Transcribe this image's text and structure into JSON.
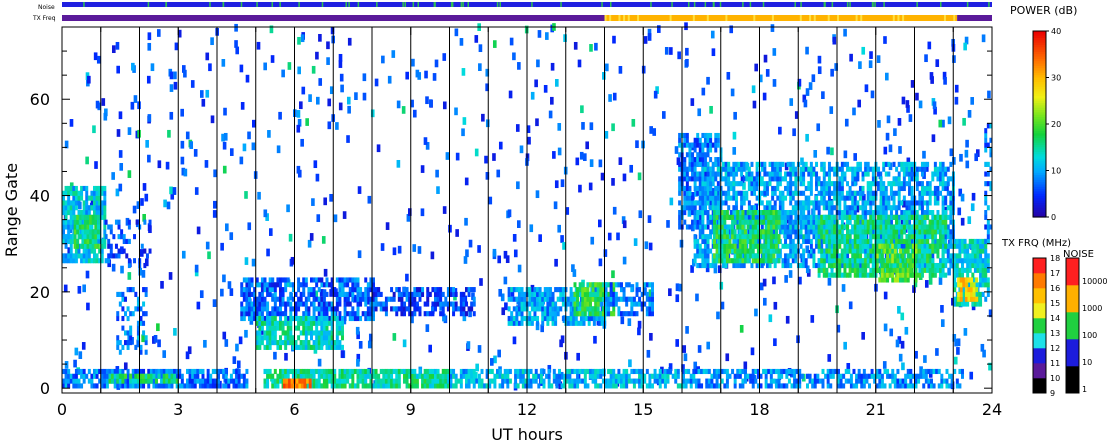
{
  "chart_data": {
    "type": "heatmap",
    "xlabel": "UT hours",
    "ylabel": "Range Gate",
    "xlim": [
      0,
      24
    ],
    "ylim": [
      -1,
      75
    ],
    "x_ticks": [
      0,
      3,
      6,
      9,
      12,
      15,
      18,
      21,
      24
    ],
    "y_ticks": [
      0,
      20,
      40,
      60
    ],
    "vertical_beam_lines_hours": [
      1,
      2,
      3,
      4,
      5,
      6,
      7,
      8,
      9,
      10,
      11,
      12,
      13,
      14,
      15,
      16,
      17,
      18,
      19,
      20,
      21,
      22,
      23
    ],
    "header_bars": {
      "noise_label": "Noise",
      "freq_label": "TX Freq",
      "noise_color": "#2020e0",
      "freq_segments": [
        {
          "from_hour": 0,
          "to_hour": 14,
          "color": "#5a1a9a"
        },
        {
          "from_hour": 14,
          "to_hour": 23.1,
          "color": "#ffb300"
        },
        {
          "from_hour": 23.1,
          "to_hour": 24,
          "color": "#5a1a9a"
        }
      ]
    },
    "power_colorbar": {
      "title": "POWER (dB)",
      "range": [
        0,
        40
      ],
      "ticks": [
        0,
        10,
        20,
        30,
        40
      ]
    },
    "freq_colorbar": {
      "title": "TX FRQ (MHz)",
      "ticks": [
        9,
        10,
        11,
        12,
        13,
        14,
        15,
        16,
        17,
        18
      ],
      "colors": [
        "#000000",
        "#5a1a9a",
        "#1c1cdc",
        "#1ee0e8",
        "#20d040",
        "#f0f020",
        "#ffc000",
        "#ff7a00",
        "#ff2020"
      ]
    },
    "noise_colorbar": {
      "title": "NOISE",
      "ticks": [
        "1",
        "10",
        "100",
        "1000",
        "10000"
      ],
      "colors": [
        "#000000",
        "#1c1cdc",
        "#20d040",
        "#ffb000",
        "#ff2020"
      ]
    },
    "echo_regions": [
      {
        "t0": 0.0,
        "t1": 1.1,
        "g0": 26,
        "g1": 42,
        "power": 12,
        "density": 0.75
      },
      {
        "t0": 0.3,
        "t1": 0.9,
        "g0": 29,
        "g1": 36,
        "power": 17,
        "density": 0.8
      },
      {
        "t0": 1.1,
        "t1": 2.3,
        "g0": 25,
        "g1": 35,
        "power": 6,
        "density": 0.25
      },
      {
        "t0": 1.4,
        "t1": 2.2,
        "g0": 7,
        "g1": 21,
        "power": 8,
        "density": 0.35
      },
      {
        "t0": 0.0,
        "t1": 4.8,
        "g0": 0,
        "g1": 4,
        "power": 8,
        "density": 0.8
      },
      {
        "t0": 1.2,
        "t1": 3.0,
        "g0": 1,
        "g1": 3,
        "power": 16,
        "density": 0.75
      },
      {
        "t0": 4.6,
        "t1": 8.0,
        "g0": 14,
        "g1": 23,
        "power": 7,
        "density": 0.7
      },
      {
        "t0": 5.0,
        "t1": 7.2,
        "g0": 8,
        "g1": 15,
        "power": 14,
        "density": 0.75
      },
      {
        "t0": 8.0,
        "t1": 10.6,
        "g0": 15,
        "g1": 21,
        "power": 6,
        "density": 0.6
      },
      {
        "t0": 5.2,
        "t1": 10.0,
        "g0": 0,
        "g1": 4,
        "power": 15,
        "density": 0.85
      },
      {
        "t0": 5.7,
        "t1": 6.4,
        "g0": 0,
        "g1": 2,
        "power": 33,
        "density": 0.85
      },
      {
        "t0": 10.0,
        "t1": 16.0,
        "g0": 0,
        "g1": 4,
        "power": 11,
        "density": 0.7
      },
      {
        "t0": 16.0,
        "t1": 23.2,
        "g0": 0,
        "g1": 4,
        "power": 9,
        "density": 0.6
      },
      {
        "t0": 11.5,
        "t1": 14.0,
        "g0": 13,
        "g1": 21,
        "power": 10,
        "density": 0.75
      },
      {
        "t0": 13.2,
        "t1": 14.2,
        "g0": 15,
        "g1": 22,
        "power": 18,
        "density": 0.8
      },
      {
        "t0": 14.0,
        "t1": 15.2,
        "g0": 15,
        "g1": 22,
        "power": 8,
        "density": 0.6
      },
      {
        "t0": 15.9,
        "t1": 17.0,
        "g0": 33,
        "g1": 53,
        "power": 8,
        "density": 0.65
      },
      {
        "t0": 16.3,
        "t1": 23.0,
        "g0": 25,
        "g1": 47,
        "power": 10,
        "density": 0.7
      },
      {
        "t0": 16.8,
        "t1": 18.5,
        "g0": 26,
        "g1": 37,
        "power": 17,
        "density": 0.75
      },
      {
        "t0": 19.5,
        "t1": 22.8,
        "g0": 23,
        "g1": 36,
        "power": 16,
        "density": 0.75
      },
      {
        "t0": 21.0,
        "t1": 22.0,
        "g0": 22,
        "g1": 30,
        "power": 20,
        "density": 0.7
      },
      {
        "t0": 23.0,
        "t1": 23.9,
        "g0": 17,
        "g1": 31,
        "power": 13,
        "density": 0.8
      },
      {
        "t0": 23.1,
        "t1": 23.6,
        "g0": 18,
        "g1": 23,
        "power": 28,
        "density": 0.75
      },
      {
        "t0": 23.8,
        "t1": 24.0,
        "g0": 30,
        "g1": 56,
        "power": 8,
        "density": 0.4
      }
    ]
  }
}
